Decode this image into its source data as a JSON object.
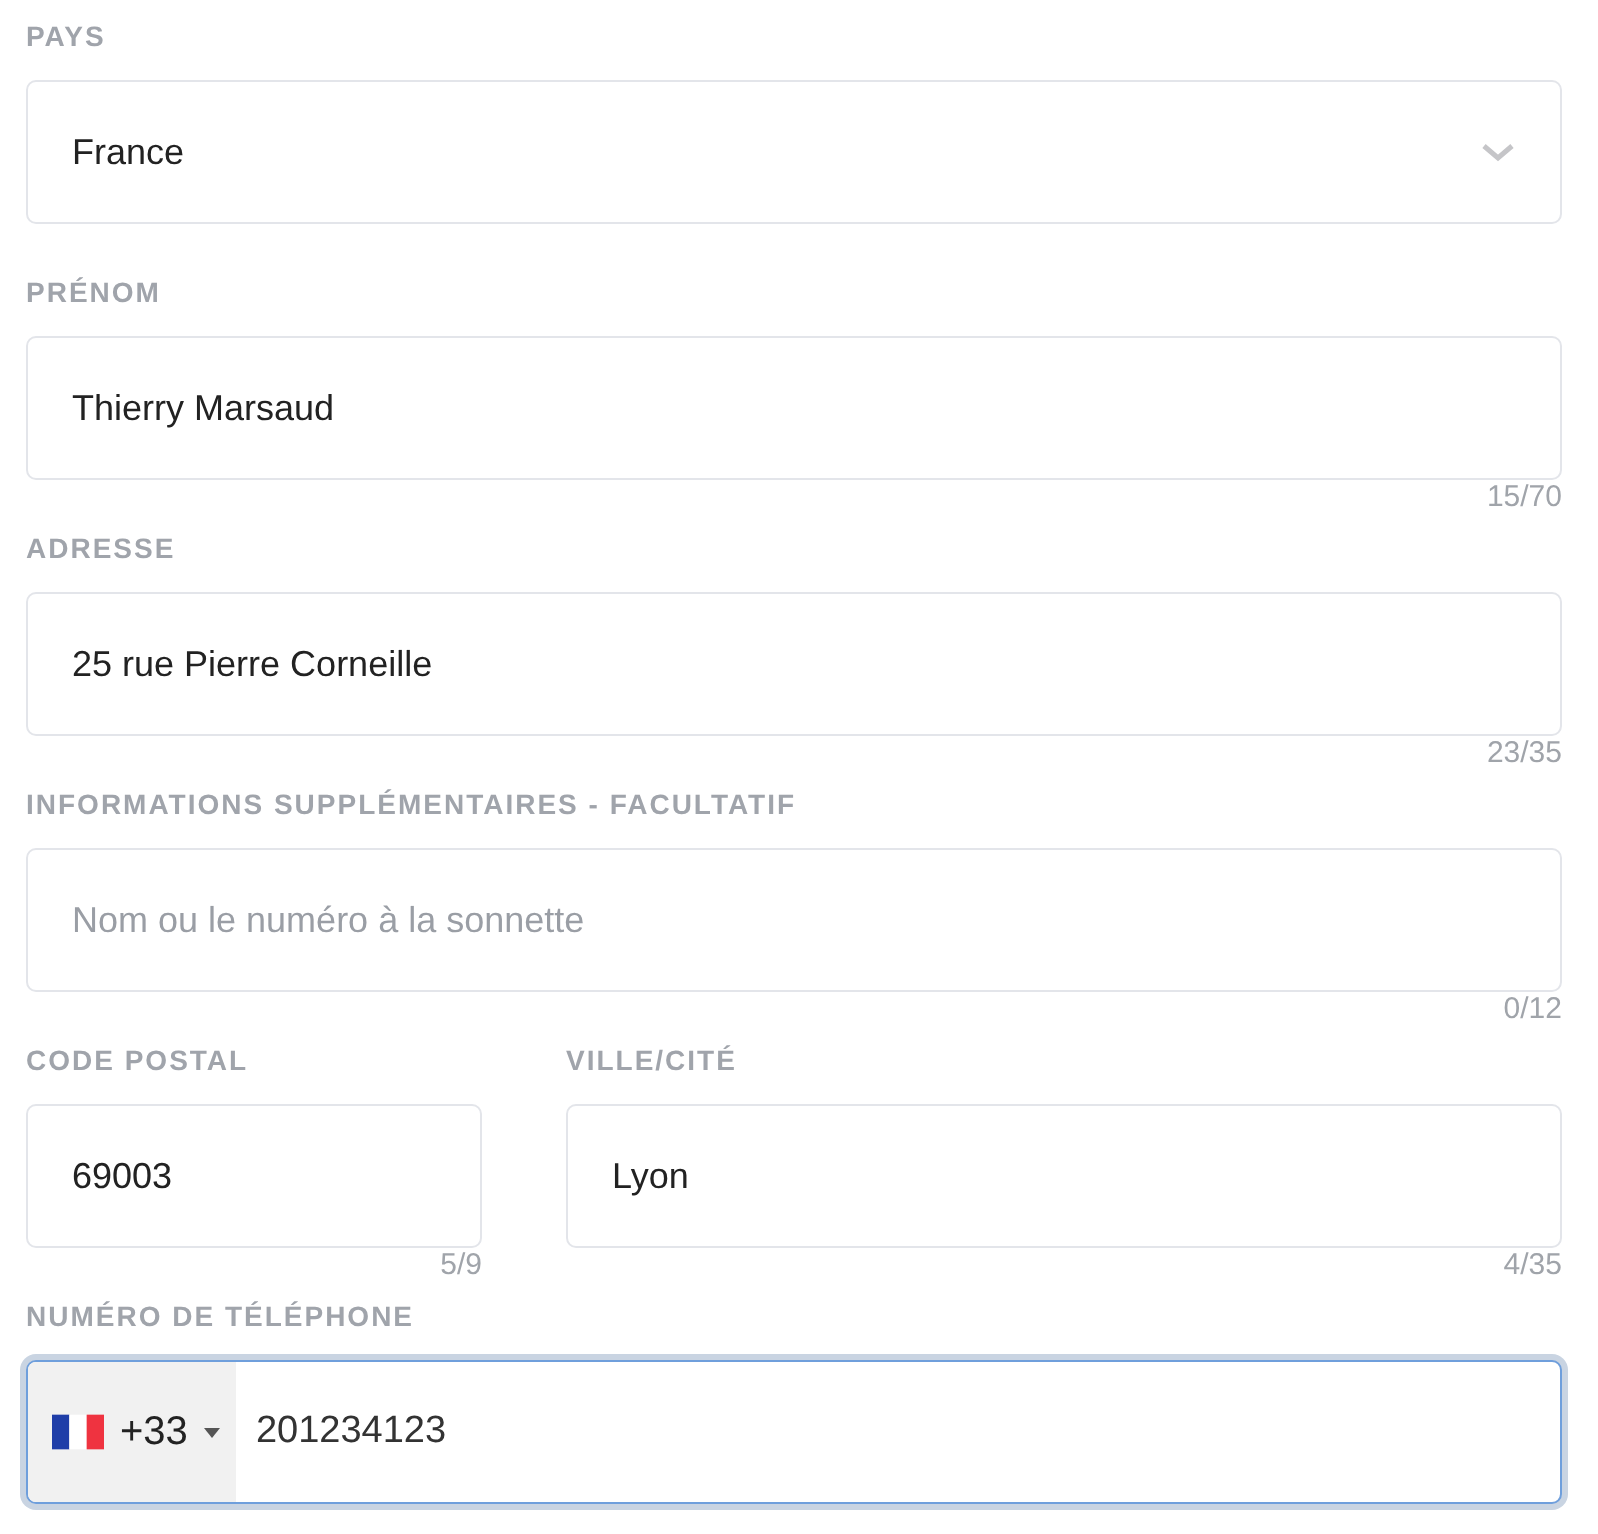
{
  "rows": [
    {
      "fields": [
        {
          "kind": "select",
          "label": "PAYS",
          "value": "France",
          "focused": false
        }
      ]
    },
    {
      "fields": [
        {
          "kind": "text",
          "label": "PRÉNOM",
          "value": "Thierry Marsaud",
          "counter": "15/70",
          "focused": false
        }
      ]
    },
    {
      "fields": [
        {
          "kind": "text",
          "label": "ADRESSE",
          "value": "25 rue Pierre Corneille",
          "counter": "23/35",
          "focused": false
        }
      ]
    },
    {
      "fields": [
        {
          "kind": "text",
          "label": "INFORMATIONS SUPPLÉMENTAIRES - FACULTATIF",
          "placeholder": "Nom ou le numéro à la sonnette",
          "counter": "0/12",
          "focused": false
        }
      ]
    },
    {
      "fields": [
        {
          "kind": "text",
          "label": "CODE POSTAL",
          "value": "69003",
          "counter": "5/9",
          "focused": false
        },
        {
          "kind": "text",
          "label": "VILLE/CITÉ",
          "value": "Lyon",
          "counter": "4/35",
          "focused": false
        }
      ]
    },
    {
      "fields": [
        {
          "kind": "phone",
          "label": "NUMÉRO DE TÉLÉPHONE",
          "country_code": "+33",
          "value": "201234123",
          "focused": true
        }
      ]
    }
  ]
}
